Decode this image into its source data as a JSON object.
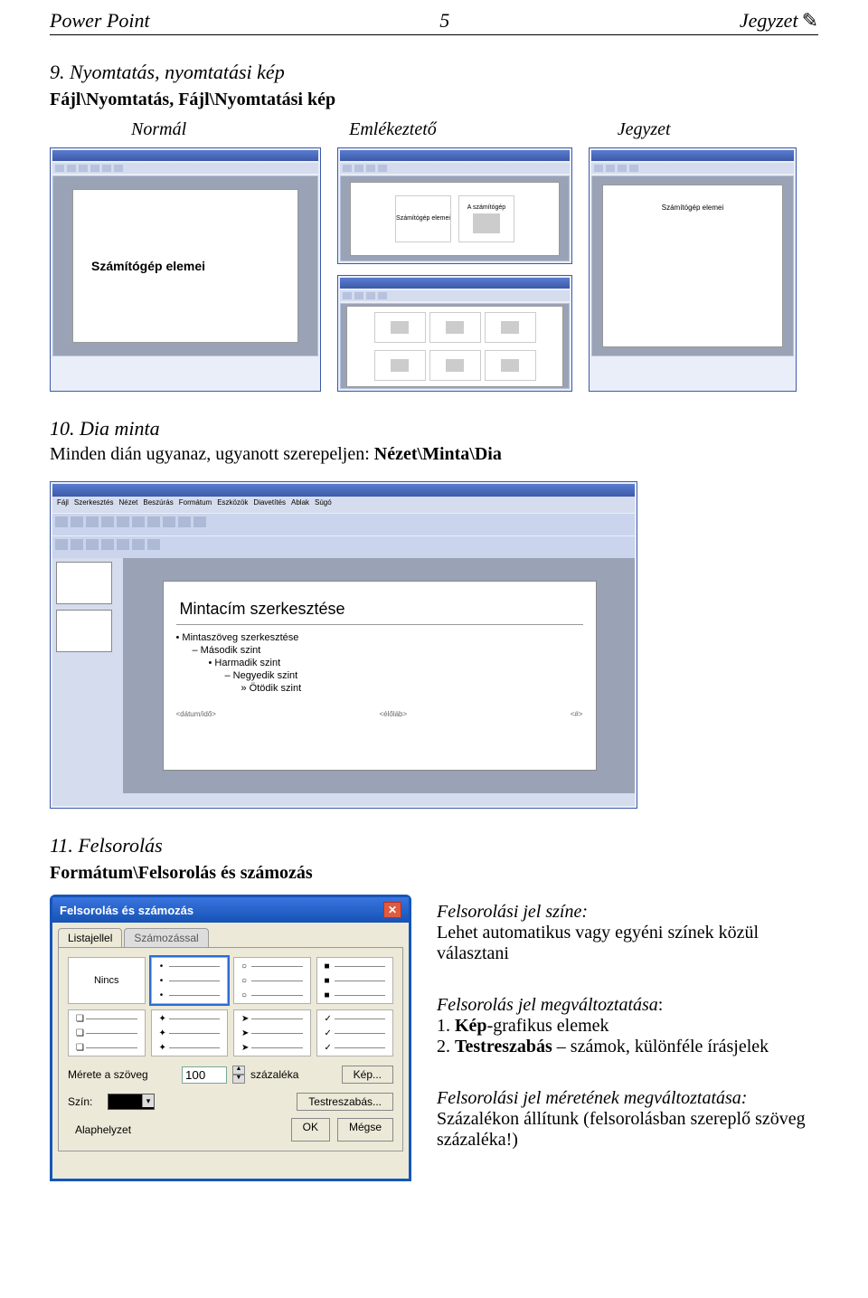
{
  "header": {
    "left": "Power Point",
    "page_no": "5",
    "right": "Jegyzet",
    "pencil_glyph": "✎"
  },
  "s9": {
    "title": "9. Nyomtatás, nyomtatási kép",
    "path": "Fájl\\Nyomtatás, Fájl\\Nyomtatási kép",
    "cols": {
      "c1": "Normál",
      "c2": "Emlékeztető",
      "c3": "Jegyzet"
    },
    "shotA_text": "Számítógép elemei",
    "shotB_cells": [
      "Számítógép elemei",
      "A számítógép"
    ],
    "shotC_text": "Számítógép elemei"
  },
  "s10": {
    "title": "10. Dia minta",
    "line": "Minden dián ugyanaz, ugyanott szerepeljen:",
    "path": "Nézet\\Minta\\Dia",
    "menus": [
      "Fájl",
      "Szerkesztés",
      "Nézet",
      "Beszúrás",
      "Formátum",
      "Eszközök",
      "Diavetítés",
      "Ablak",
      "Súgó"
    ],
    "slide": {
      "title": "Mintacím szerkesztése",
      "sub0": "• Mintaszöveg szerkesztése",
      "sub1": "– Második szint",
      "sub2": "• Harmadik szint",
      "sub3": "– Negyedik szint",
      "sub4": "» Ötödik szint",
      "foot_l": "<dátum/idő>",
      "foot_m": "<élőláb>",
      "foot_r": "<#>"
    }
  },
  "s11": {
    "title": "11. Felsorolás",
    "path": "Formátum\\Felsorolás és számozás",
    "dlg": {
      "title": "Felsorolás és számozás",
      "tab1": "Listajellel",
      "tab2": "Számozással",
      "none": "Nincs",
      "size_lbl": "Mérete a szöveg",
      "size_val": "100",
      "size_suffix": "százaléka",
      "color_lbl": "Szín:",
      "btn_pic": "Kép...",
      "btn_custom": "Testreszabás...",
      "btn_reset": "Alaphelyzet",
      "btn_ok": "OK",
      "btn_cancel": "Mégse"
    },
    "desc": {
      "h1": "Felsorolási jel színe:",
      "p1": "Lehet automatikus vagy egyéni színek közül választani",
      "h2_a": "Felsorolás jel megváltoztatása",
      "h2_b": ":",
      "li1_n": "1. ",
      "li1_b": "Kép",
      "li1_t": "-grafikus elemek",
      "li2_n": "2. ",
      "li2_b": "Testreszabás",
      "li2_t": " – számok, különféle írásjelek",
      "h3": "Felsorolási jel méretének megváltoztatása:",
      "p3": "Százalékon állítunk (felsorolásban szereplő szöveg százaléka!)"
    }
  }
}
